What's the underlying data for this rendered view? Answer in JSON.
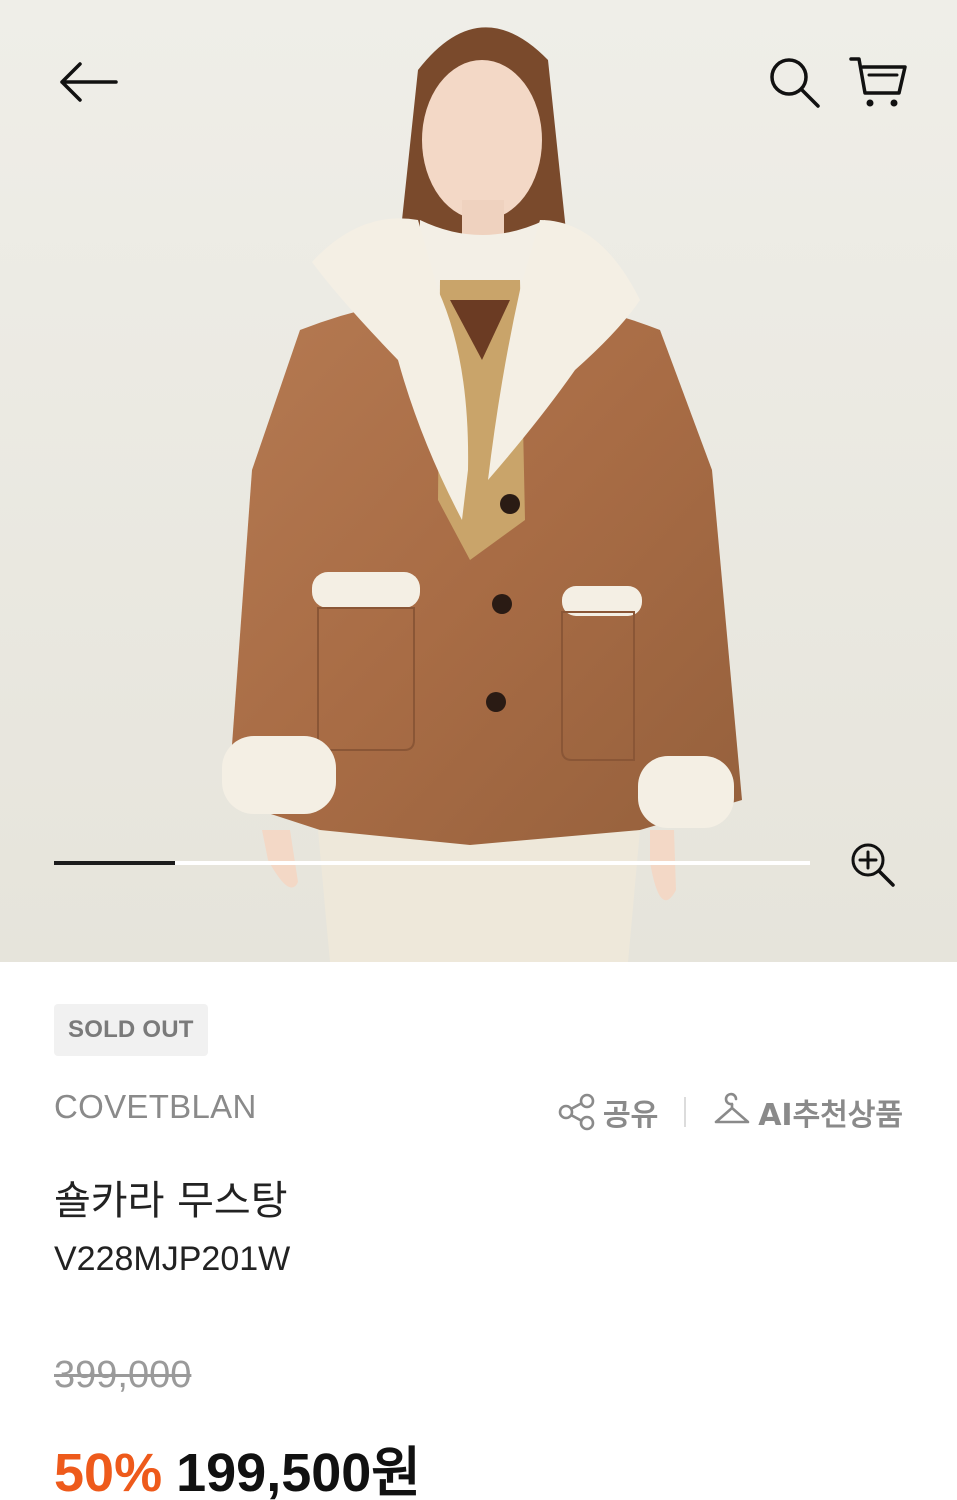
{
  "hero": {
    "image": "model-in-brown-shearling-mustang-jacket",
    "carousel_progress": 0.16
  },
  "nav": {
    "back_icon": "arrow-left-icon",
    "search_icon": "search-icon",
    "cart_icon": "cart-icon",
    "zoom_icon": "zoom-in-icon"
  },
  "product": {
    "badge": "SOLD OUT",
    "brand": "COVETBLAN",
    "name": "숄카라 무스탕",
    "code": "V228MJP201W",
    "original_price": "399,000",
    "discount": "50%",
    "sale_price": "199,500원"
  },
  "actions": {
    "share_label": "공유",
    "ai_label": "AI추천상품"
  },
  "colors": {
    "accent": "#ee5a1b",
    "badge_bg": "#f1f1f1",
    "muted_text": "#8a8a8a"
  }
}
